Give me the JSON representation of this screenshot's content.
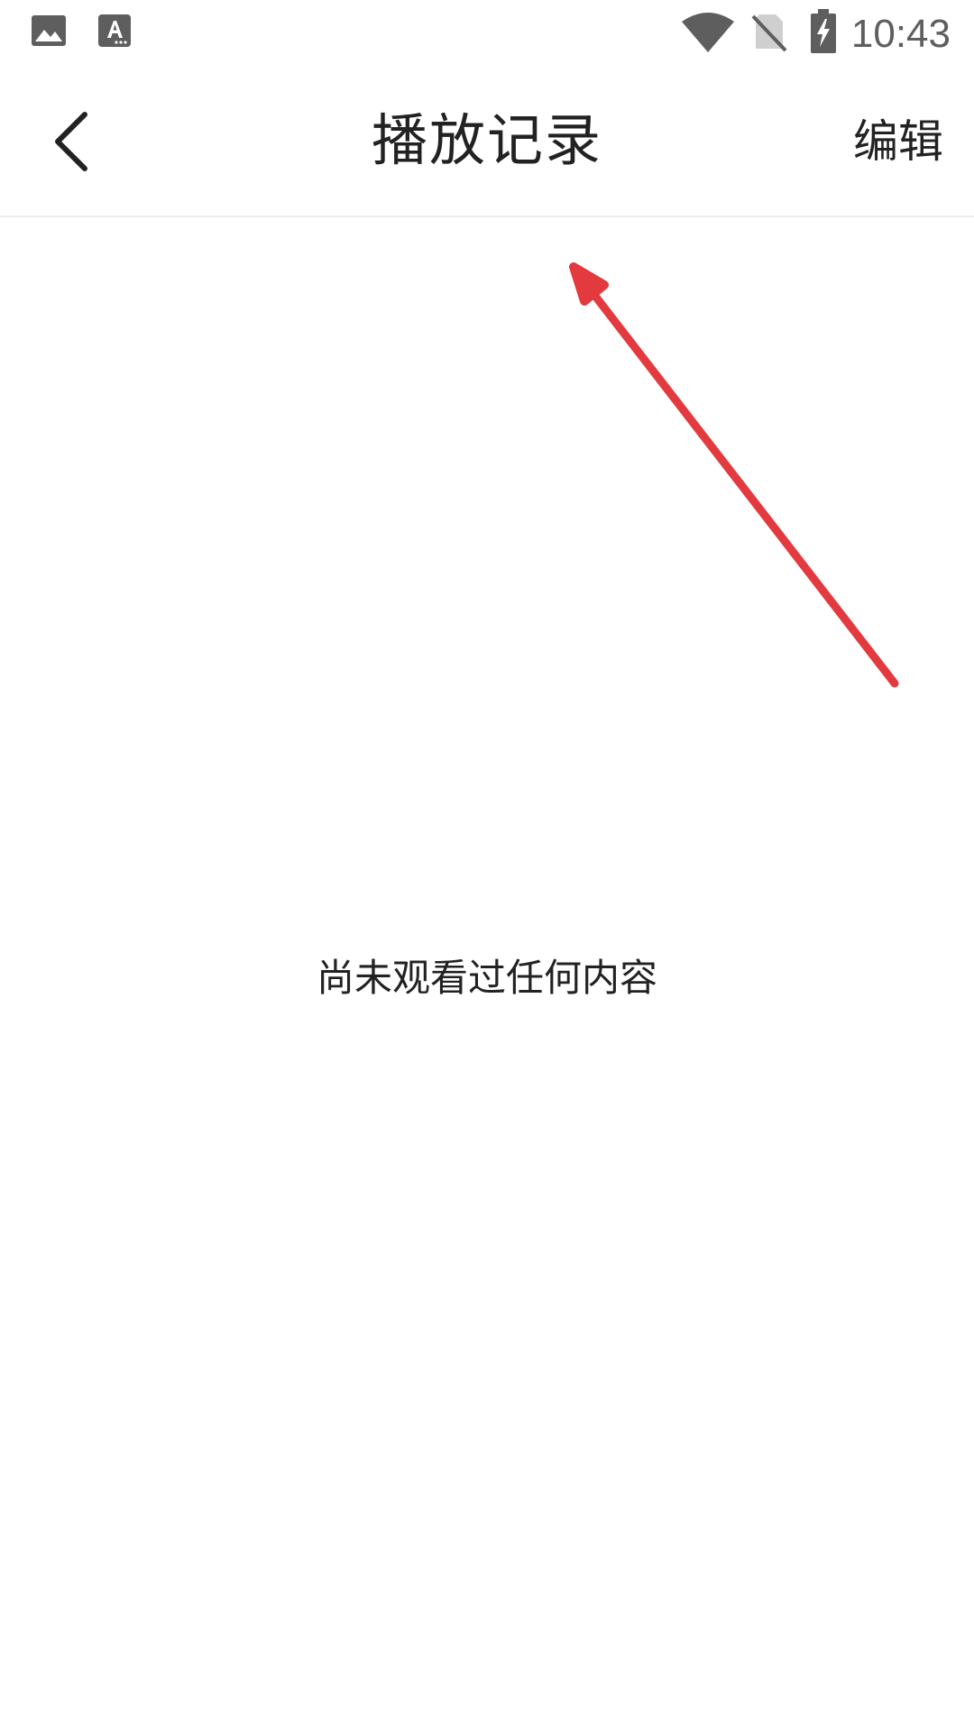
{
  "status_bar": {
    "time": "10:43",
    "icons": [
      "gallery-icon",
      "font-download-icon",
      "wifi-icon",
      "no-sim-icon",
      "battery-charging-icon"
    ]
  },
  "app_bar": {
    "back_icon": "chevron-left-icon",
    "title": "播放记录",
    "edit_label": "编辑"
  },
  "content": {
    "empty_message": "尚未观看过任何内容"
  },
  "colors": {
    "annotation_arrow": "#e23a3f",
    "status_icons": "#5e5e5e",
    "text": "#222222",
    "divider": "#ececec"
  }
}
